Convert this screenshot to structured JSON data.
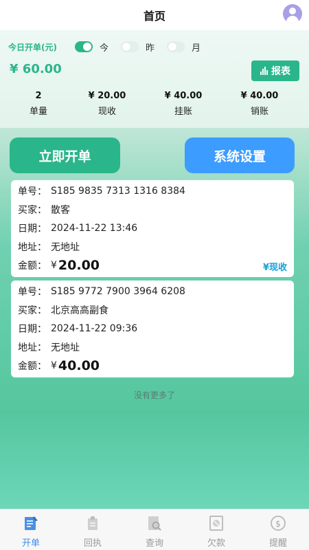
{
  "header": {
    "title": "首页",
    "avatar_icon": "user-avatar-icon"
  },
  "summary": {
    "today_label": "今日开单(元)",
    "periods": [
      {
        "label": "今",
        "active": true
      },
      {
        "label": "昨",
        "active": false
      },
      {
        "label": "月",
        "active": false
      }
    ],
    "total": "¥ 60.00",
    "report_label": "报表",
    "stats": [
      {
        "value": "2",
        "label": "单量"
      },
      {
        "value": "¥ 20.00",
        "label": "现收"
      },
      {
        "value": "¥ 40.00",
        "label": "挂账"
      },
      {
        "value": "¥ 40.00",
        "label": "销账"
      }
    ]
  },
  "actions": {
    "open_label": "立即开单",
    "settings_label": "系统设置"
  },
  "orders": [
    {
      "order_no_label": "单号：",
      "order_no": "S185 9835 7313 1316 8384",
      "buyer_label": "买家：",
      "buyer": "散客",
      "date_label": "日期：",
      "date": "2024-11-22 13:46",
      "address_label": "地址：",
      "address": "无地址",
      "amount_label": "金额：",
      "currency": "¥",
      "amount": "20.00",
      "status": "¥现收"
    },
    {
      "order_no_label": "单号：",
      "order_no": "S185 9772 7900 3964 6208",
      "buyer_label": "买家：",
      "buyer": "北京高高副食",
      "date_label": "日期：",
      "date": "2024-11-22 09:36",
      "address_label": "地址：",
      "address": "无地址",
      "amount_label": "金额：",
      "currency": "¥",
      "amount": "40.00",
      "status": ""
    }
  ],
  "footer_note": "没有更多了",
  "tabs": [
    {
      "label": "开单",
      "icon": "open-order-icon",
      "active": true
    },
    {
      "label": "回执",
      "icon": "receipt-icon",
      "active": false
    },
    {
      "label": "查询",
      "icon": "search-icon",
      "active": false
    },
    {
      "label": "欠款",
      "icon": "debt-icon",
      "active": false
    },
    {
      "label": "提醒",
      "icon": "reminder-icon",
      "active": false
    }
  ],
  "colors": {
    "accent_green": "#2bb58a",
    "accent_blue": "#3d9cff",
    "status_blue": "#1aa0d6"
  }
}
